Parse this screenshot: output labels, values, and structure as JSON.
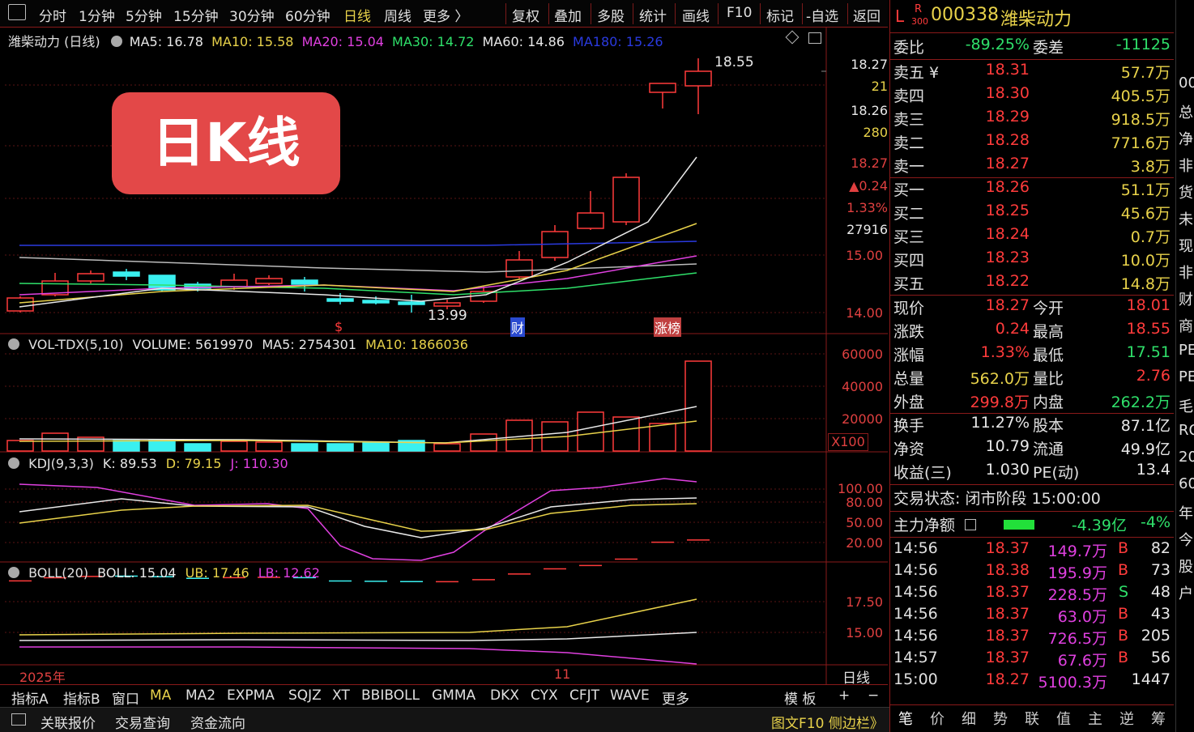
{
  "toolbar": {
    "periods": [
      "分时",
      "1分钟",
      "5分钟",
      "15分钟",
      "30分钟",
      "60分钟",
      "日线",
      "周线",
      "更多 〉"
    ],
    "active_period": "日线",
    "tools": [
      "复权",
      "叠加",
      "多股",
      "统计",
      "画线",
      "F10",
      "标记",
      "-自选",
      "返回"
    ]
  },
  "main_chart": {
    "title": "潍柴动力 (日线)",
    "ma": [
      {
        "label": "MA5: 16.78",
        "color": "#e8e8e8"
      },
      {
        "label": "MA10: 15.58",
        "color": "#e8d24a"
      },
      {
        "label": "MA20: 15.04",
        "color": "#e040e0"
      },
      {
        "label": "MA30: 14.72",
        "color": "#2fe06a"
      },
      {
        "label": "MA60: 14.86",
        "color": "#e8e8e8"
      },
      {
        "label": "MA180: 15.26",
        "color": "#2a3ae0"
      }
    ],
    "high_label": "18.55",
    "low_label": "13.99",
    "markers": {
      "dollar": "$",
      "cai": "财",
      "zhangbang": "涨榜"
    },
    "axis": [
      "15.00",
      "14.00"
    ],
    "side_info": [
      "18.27",
      "21",
      "18.26",
      "280",
      "18.27",
      "▲0.24",
      "1.33%",
      "27916"
    ],
    "badge": "日K线"
  },
  "volume_chart": {
    "title": "VOL-TDX(5,10)",
    "volume": "VOLUME: 5619970",
    "ma5": "MA5: 2754301",
    "ma10": "MA10: 1866036",
    "axis": [
      "60000",
      "40000",
      "20000"
    ],
    "unit": "X100"
  },
  "kdj_chart": {
    "title": "KDJ(9,3,3)",
    "k": "K: 89.53",
    "d": "D: 79.15",
    "j": "J: 110.30",
    "axis": [
      "100.00",
      "80.00",
      "50.00",
      "20.00"
    ]
  },
  "boll_chart": {
    "title": "BOLL(20)",
    "boll": "BOLL: 15.04",
    "ub": "UB: 17.46",
    "lb": "LB: 12.62",
    "axis": [
      "17.50",
      "15.00"
    ],
    "year": "2025年",
    "month": "11",
    "corner": "日线"
  },
  "indicator_tabs": [
    "指标A",
    "指标B",
    "窗口",
    "MA",
    "MA2",
    "EXPMA",
    "SQJZ",
    "XT",
    "BBIBOLL",
    "GMMA",
    "DKX",
    "CYX",
    "CFJT",
    "WAVE",
    "更多"
  ],
  "indicator_right": [
    "模 板",
    "+",
    "−"
  ],
  "status_bar": {
    "items": [
      "关联报价",
      "交易查询",
      "资金流向"
    ],
    "right": "图文F10 侧边栏》"
  },
  "quote": {
    "prefix": "L",
    "badge_r": "R",
    "badge_300": "300",
    "code": "000338",
    "name": "潍柴动力",
    "weibi_label": "委比",
    "weibi": "-89.25%",
    "weicha_label": "委差",
    "weicha": "-11125",
    "sell": [
      {
        "label": "卖五 ¥",
        "price": "18.31",
        "vol": "57.7万"
      },
      {
        "label": "卖四",
        "price": "18.30",
        "vol": "405.5万"
      },
      {
        "label": "卖三",
        "price": "18.29",
        "vol": "918.5万"
      },
      {
        "label": "卖二",
        "price": "18.28",
        "vol": "771.6万"
      },
      {
        "label": "卖一",
        "price": "18.27",
        "vol": "3.8万"
      }
    ],
    "buy": [
      {
        "label": "买一",
        "price": "18.26",
        "vol": "51.1万"
      },
      {
        "label": "买二",
        "price": "18.25",
        "vol": "45.6万"
      },
      {
        "label": "买三",
        "price": "18.24",
        "vol": "0.7万"
      },
      {
        "label": "买四",
        "price": "18.23",
        "vol": "10.0万"
      },
      {
        "label": "买五",
        "price": "18.22",
        "vol": "14.8万"
      }
    ],
    "stats": [
      {
        "l1": "现价",
        "v1": "18.27",
        "l2": "今开",
        "v2": "18.01",
        "c1": "red",
        "c2": "red"
      },
      {
        "l1": "涨跌",
        "v1": "0.24",
        "l2": "最高",
        "v2": "18.55",
        "c1": "red",
        "c2": "red"
      },
      {
        "l1": "涨幅",
        "v1": "1.33%",
        "l2": "最低",
        "v2": "17.51",
        "c1": "red",
        "c2": "green"
      },
      {
        "l1": "总量",
        "v1": "562.0万",
        "l2": "量比",
        "v2": "2.76",
        "c1": "yellow",
        "c2": "red"
      },
      {
        "l1": "外盘",
        "v1": "299.8万",
        "l2": "内盘",
        "v2": "262.2万",
        "c1": "red",
        "c2": "green"
      }
    ],
    "stats2": [
      {
        "l1": "换手",
        "v1": "11.27%",
        "l2": "股本",
        "v2": "87.1亿"
      },
      {
        "l1": "净资",
        "v1": "10.79",
        "l2": "流通",
        "v2": "49.9亿"
      },
      {
        "l1": "收益(三)",
        "v1": "1.030",
        "l2": "PE(动)",
        "v2": "13.4"
      }
    ],
    "trade_status": "交易状态: 闭市阶段 15:00:00",
    "main_net_label": "主力净额",
    "main_net_value": "-4.39亿",
    "main_net_pct": "-4%",
    "ticks": [
      {
        "time": "14:56",
        "price": "18.37",
        "amt": "149.7万",
        "side": "B",
        "n": "82"
      },
      {
        "time": "14:56",
        "price": "18.38",
        "amt": "195.9万",
        "side": "B",
        "n": "73"
      },
      {
        "time": "14:56",
        "price": "18.37",
        "amt": "228.5万",
        "side": "S",
        "n": "48"
      },
      {
        "time": "14:56",
        "price": "18.37",
        "amt": "63.0万",
        "side": "B",
        "n": "43"
      },
      {
        "time": "14:56",
        "price": "18.37",
        "amt": "726.5万",
        "side": "B",
        "n": "205"
      },
      {
        "time": "14:57",
        "price": "18.37",
        "amt": "67.6万",
        "side": "B",
        "n": "56"
      },
      {
        "time": "15:00",
        "price": "18.27",
        "amt": "5100.3万",
        "side": "",
        "n": "1447"
      }
    ],
    "bottom_tabs": [
      "笔",
      "价",
      "细",
      "势",
      "联",
      "值",
      "主",
      "逆",
      "筹"
    ]
  },
  "edge": [
    "00",
    "总",
    "净",
    "非",
    "货",
    "未",
    "现",
    "非",
    "财",
    "商",
    "PE",
    "PE",
    "毛",
    "RO",
    "20",
    "60",
    "年",
    "今",
    "股",
    "户"
  ]
}
